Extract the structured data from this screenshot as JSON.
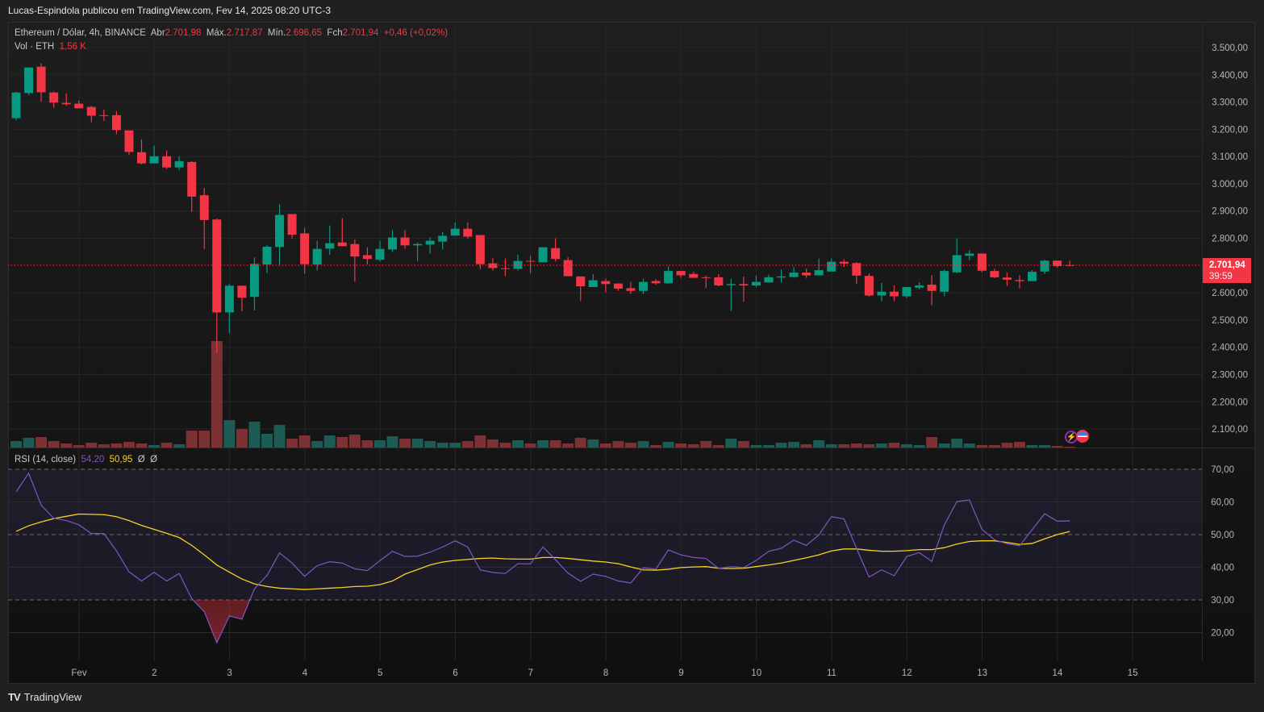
{
  "topline": "Lucas-Espindola publicou em TradingView.com, Fev 14, 2025 08:20 UTC-3",
  "legend": {
    "symbol": "Ethereum / Dólar, 4h, BINANCE",
    "open_label": "Abr",
    "open": "2.701,98",
    "high_label": "Máx.",
    "high": "2.717,87",
    "low_label": "Mín.",
    "low": "2.696,65",
    "close_label": "Fch",
    "close": "2.701,94",
    "change": "+0,46 (+0,02%)",
    "vol_label": "Vol · ETH",
    "vol": "1,56 K"
  },
  "rsi_legend": {
    "label": "RSI (14, close)",
    "rsi": "54,20",
    "ma": "50,95",
    "extra1": "Ø",
    "extra2": "Ø"
  },
  "price_tag": {
    "price": "2.701,94",
    "countdown": "39:59"
  },
  "footer": {
    "logo": "TV",
    "brand": "TradingView"
  },
  "colors": {
    "up": "#089981",
    "down": "#f23645",
    "vol_up": "#1d5b55",
    "vol_down": "#7c3134",
    "rsi": "#7e57c2",
    "rsi_ma": "#f7d126"
  },
  "chart_data": {
    "type": "candlestick",
    "symbol": "ETH/USD 4h BINANCE",
    "price_axis": {
      "labels": [
        "3.500,00",
        "3.400,00",
        "3.300,00",
        "3.200,00",
        "3.100,00",
        "3.000,00",
        "2.900,00",
        "2.800,00",
        "2.700,00",
        "2.600,00",
        "2.500,00",
        "2.400,00",
        "2.300,00",
        "2.200,00",
        "2.100,00"
      ],
      "values": [
        3500,
        3400,
        3300,
        3200,
        3100,
        3000,
        2900,
        2800,
        2700,
        2600,
        2500,
        2400,
        2300,
        2200,
        2100
      ]
    },
    "rsi_axis": {
      "labels": [
        "70,00",
        "60,00",
        "50,00",
        "40,00",
        "30,00",
        "20,00"
      ],
      "values": [
        70,
        60,
        50,
        40,
        30,
        20
      ],
      "band": [
        30,
        70
      ]
    },
    "time_axis": {
      "labels": [
        "Fev",
        "2",
        "3",
        "4",
        "5",
        "6",
        "7",
        "8",
        "9",
        "10",
        "11",
        "12",
        "13",
        "14",
        "15"
      ]
    },
    "first_candle": "Jan 31 04:00",
    "candles_ohlc": [
      [
        3241,
        3338,
        3234,
        3335
      ],
      [
        3333,
        3427,
        3326,
        3427
      ],
      [
        3430,
        3442,
        3301,
        3336
      ],
      [
        3335,
        3338,
        3279,
        3298
      ],
      [
        3297,
        3332,
        3286,
        3292
      ],
      [
        3294,
        3306,
        3277,
        3277
      ],
      [
        3282,
        3286,
        3226,
        3250
      ],
      [
        3252,
        3273,
        3231,
        3250
      ],
      [
        3252,
        3267,
        3182,
        3197
      ],
      [
        3196,
        3196,
        3105,
        3117
      ],
      [
        3116,
        3163,
        3071,
        3075
      ],
      [
        3075,
        3140,
        3075,
        3101
      ],
      [
        3101,
        3122,
        3054,
        3060
      ],
      [
        3060,
        3101,
        3051,
        3083
      ],
      [
        3080,
        3083,
        2897,
        2953
      ],
      [
        2958,
        2985,
        2761,
        2867
      ],
      [
        2869,
        2873,
        2380,
        2528
      ],
      [
        2528,
        2632,
        2452,
        2626
      ],
      [
        2626,
        2626,
        2532,
        2582
      ],
      [
        2585,
        2730,
        2535,
        2706
      ],
      [
        2704,
        2775,
        2672,
        2769
      ],
      [
        2768,
        2925,
        2700,
        2886
      ],
      [
        2889,
        2889,
        2798,
        2813
      ],
      [
        2818,
        2839,
        2670,
        2705
      ],
      [
        2704,
        2791,
        2682,
        2761
      ],
      [
        2762,
        2847,
        2739,
        2782
      ],
      [
        2785,
        2874,
        2771,
        2771
      ],
      [
        2779,
        2796,
        2641,
        2733
      ],
      [
        2738,
        2767,
        2704,
        2724
      ],
      [
        2721,
        2791,
        2715,
        2761
      ],
      [
        2759,
        2830,
        2750,
        2803
      ],
      [
        2803,
        2830,
        2762,
        2774
      ],
      [
        2774,
        2785,
        2717,
        2779
      ],
      [
        2777,
        2803,
        2744,
        2791
      ],
      [
        2788,
        2823,
        2759,
        2809
      ],
      [
        2810,
        2859,
        2810,
        2835
      ],
      [
        2835,
        2859,
        2798,
        2806
      ],
      [
        2812,
        2812,
        2687,
        2705
      ],
      [
        2708,
        2728,
        2682,
        2691
      ],
      [
        2690,
        2726,
        2661,
        2688
      ],
      [
        2688,
        2741,
        2682,
        2717
      ],
      [
        2717,
        2735,
        2673,
        2716
      ],
      [
        2712,
        2767,
        2712,
        2767
      ],
      [
        2764,
        2800,
        2715,
        2724
      ],
      [
        2720,
        2731,
        2661,
        2661
      ],
      [
        2660,
        2660,
        2570,
        2624
      ],
      [
        2621,
        2669,
        2621,
        2646
      ],
      [
        2643,
        2652,
        2601,
        2632
      ],
      [
        2634,
        2634,
        2607,
        2615
      ],
      [
        2617,
        2640,
        2595,
        2607
      ],
      [
        2607,
        2652,
        2595,
        2640
      ],
      [
        2643,
        2649,
        2630,
        2635
      ],
      [
        2635,
        2697,
        2632,
        2680
      ],
      [
        2680,
        2680,
        2655,
        2664
      ],
      [
        2669,
        2677,
        2655,
        2655
      ],
      [
        2657,
        2663,
        2617,
        2656
      ],
      [
        2657,
        2669,
        2624,
        2627
      ],
      [
        2628,
        2652,
        2533,
        2632
      ],
      [
        2632,
        2660,
        2567,
        2627
      ],
      [
        2627,
        2663,
        2621,
        2640
      ],
      [
        2638,
        2666,
        2638,
        2657
      ],
      [
        2656,
        2686,
        2638,
        2660
      ],
      [
        2658,
        2694,
        2655,
        2674
      ],
      [
        2674,
        2689,
        2655,
        2664
      ],
      [
        2664,
        2726,
        2664,
        2683
      ],
      [
        2678,
        2726,
        2678,
        2714
      ],
      [
        2714,
        2723,
        2695,
        2707
      ],
      [
        2709,
        2712,
        2632,
        2663
      ],
      [
        2662,
        2671,
        2586,
        2590
      ],
      [
        2590,
        2636,
        2569,
        2604
      ],
      [
        2604,
        2627,
        2569,
        2587
      ],
      [
        2587,
        2621,
        2581,
        2621
      ],
      [
        2619,
        2639,
        2613,
        2627
      ],
      [
        2630,
        2665,
        2555,
        2607
      ],
      [
        2604,
        2685,
        2587,
        2680
      ],
      [
        2675,
        2800,
        2672,
        2738
      ],
      [
        2736,
        2756,
        2719,
        2744
      ],
      [
        2744,
        2744,
        2675,
        2681
      ],
      [
        2680,
        2688,
        2654,
        2657
      ],
      [
        2656,
        2674,
        2625,
        2648
      ],
      [
        2647,
        2665,
        2616,
        2643
      ],
      [
        2643,
        2683,
        2643,
        2677
      ],
      [
        2678,
        2721,
        2669,
        2718
      ],
      [
        2718,
        2718,
        2692,
        2698
      ],
      [
        2701.98,
        2717.87,
        2696.65,
        2701.94
      ]
    ],
    "volume_k": [
      24,
      36,
      39,
      24,
      15,
      9,
      18,
      12,
      15,
      21,
      15,
      9,
      18,
      12,
      63,
      63,
      396,
      102,
      69,
      96,
      51,
      84,
      33,
      45,
      24,
      45,
      39,
      48,
      27,
      27,
      42,
      33,
      33,
      24,
      18,
      18,
      24,
      45,
      30,
      18,
      27,
      15,
      27,
      27,
      15,
      36,
      30,
      15,
      24,
      18,
      24,
      9,
      21,
      15,
      12,
      24,
      9,
      33,
      24,
      9,
      9,
      18,
      21,
      12,
      27,
      12,
      12,
      15,
      12,
      15,
      18,
      12,
      9,
      39,
      15,
      33,
      15,
      9,
      9,
      18,
      21,
      9,
      9,
      6,
      1.56
    ],
    "rsi": [
      63.1,
      68.8,
      59.0,
      55.0,
      54.3,
      53.0,
      50.3,
      50.3,
      45.0,
      38.6,
      35.8,
      38.5,
      35.8,
      38.1,
      30.4,
      26.4,
      16.9,
      25.1,
      24.1,
      33.4,
      37.5,
      44.4,
      41.3,
      37.2,
      40.5,
      41.7,
      41.3,
      39.5,
      39.0,
      42.0,
      44.9,
      43.3,
      43.4,
      44.6,
      46.2,
      48.1,
      46.2,
      39.2,
      38.4,
      38.1,
      41.1,
      41.0,
      46.2,
      42.3,
      38.2,
      35.7,
      37.9,
      37.2,
      35.8,
      35.2,
      39.8,
      39.4,
      45.3,
      43.8,
      43.0,
      42.7,
      39.6,
      40.2,
      39.9,
      42.1,
      44.9,
      45.8,
      48.3,
      46.7,
      49.9,
      55.5,
      54.8,
      45.8,
      37.0,
      39.2,
      37.4,
      43.3,
      44.5,
      41.8,
      53.0,
      60.1,
      60.6,
      51.6,
      48.4,
      47.2,
      46.6,
      51.5,
      56.4,
      54.1,
      54.2
    ],
    "rsi_ma": [
      51.0,
      52.7,
      53.9,
      54.9,
      55.6,
      56.3,
      56.2,
      56.1,
      55.5,
      54.3,
      52.8,
      51.6,
      50.4,
      49.1,
      46.7,
      43.8,
      40.7,
      38.5,
      36.4,
      34.9,
      34.1,
      33.6,
      33.4,
      33.2,
      33.4,
      33.6,
      33.8,
      34.1,
      34.2,
      34.7,
      35.8,
      37.9,
      39.3,
      40.7,
      41.6,
      42.1,
      42.4,
      42.7,
      42.8,
      42.6,
      42.5,
      42.5,
      43.0,
      43.0,
      42.7,
      42.3,
      41.9,
      41.6,
      41.1,
      40.1,
      39.2,
      39.1,
      39.4,
      39.9,
      40.1,
      40.2,
      39.7,
      39.6,
      39.7,
      40.2,
      40.7,
      41.3,
      42.1,
      42.9,
      43.8,
      45.0,
      45.6,
      45.6,
      45.2,
      44.9,
      44.9,
      45.1,
      45.4,
      45.4,
      46.0,
      47.1,
      47.9,
      48.1,
      48.1,
      47.6,
      47.0,
      47.3,
      48.7,
      50.0,
      50.95
    ],
    "last_price": 2701.94
  }
}
